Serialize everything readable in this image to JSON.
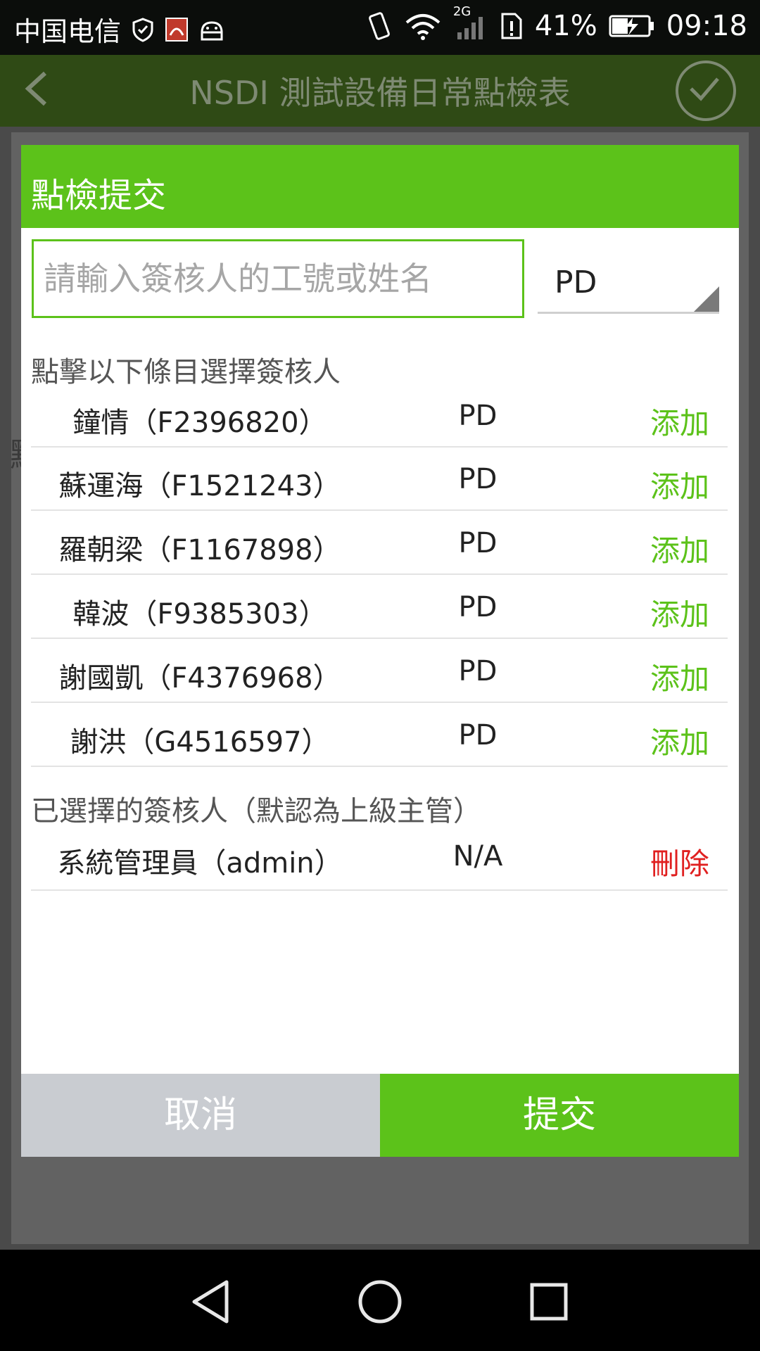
{
  "status_bar": {
    "carrier": "中国电信",
    "network": "2G",
    "battery": "41%",
    "time": "09:18"
  },
  "app_bar": {
    "title": "NSDI 測試設備日常點檢表"
  },
  "dialog": {
    "title": "點檢提交",
    "search_placeholder": "請輸入簽核人的工號或姓名",
    "department": "PD",
    "choose_label": "點擊以下條目選擇簽核人",
    "candidates": [
      {
        "name": "鐘情（F2396820）",
        "dept": "PD",
        "action": "添加"
      },
      {
        "name": "蘇運海（F1521243）",
        "dept": "PD",
        "action": "添加"
      },
      {
        "name": "羅朝梁（F1167898）",
        "dept": "PD",
        "action": "添加"
      },
      {
        "name": "韓波（F9385303）",
        "dept": "PD",
        "action": "添加"
      },
      {
        "name": "謝國凱（F4376968）",
        "dept": "PD",
        "action": "添加"
      },
      {
        "name": "謝洪（G4516597）",
        "dept": "PD",
        "action": "添加"
      }
    ],
    "selected_label": "已選擇的簽核人（默認為上級主管）",
    "selected": [
      {
        "name": "系統管理員（admin）",
        "dept": "N/A",
        "action": "刪除"
      }
    ],
    "cancel_label": "取消",
    "submit_label": "提交"
  },
  "colors": {
    "accent": "#5cc21a",
    "delete": "#e02020"
  }
}
